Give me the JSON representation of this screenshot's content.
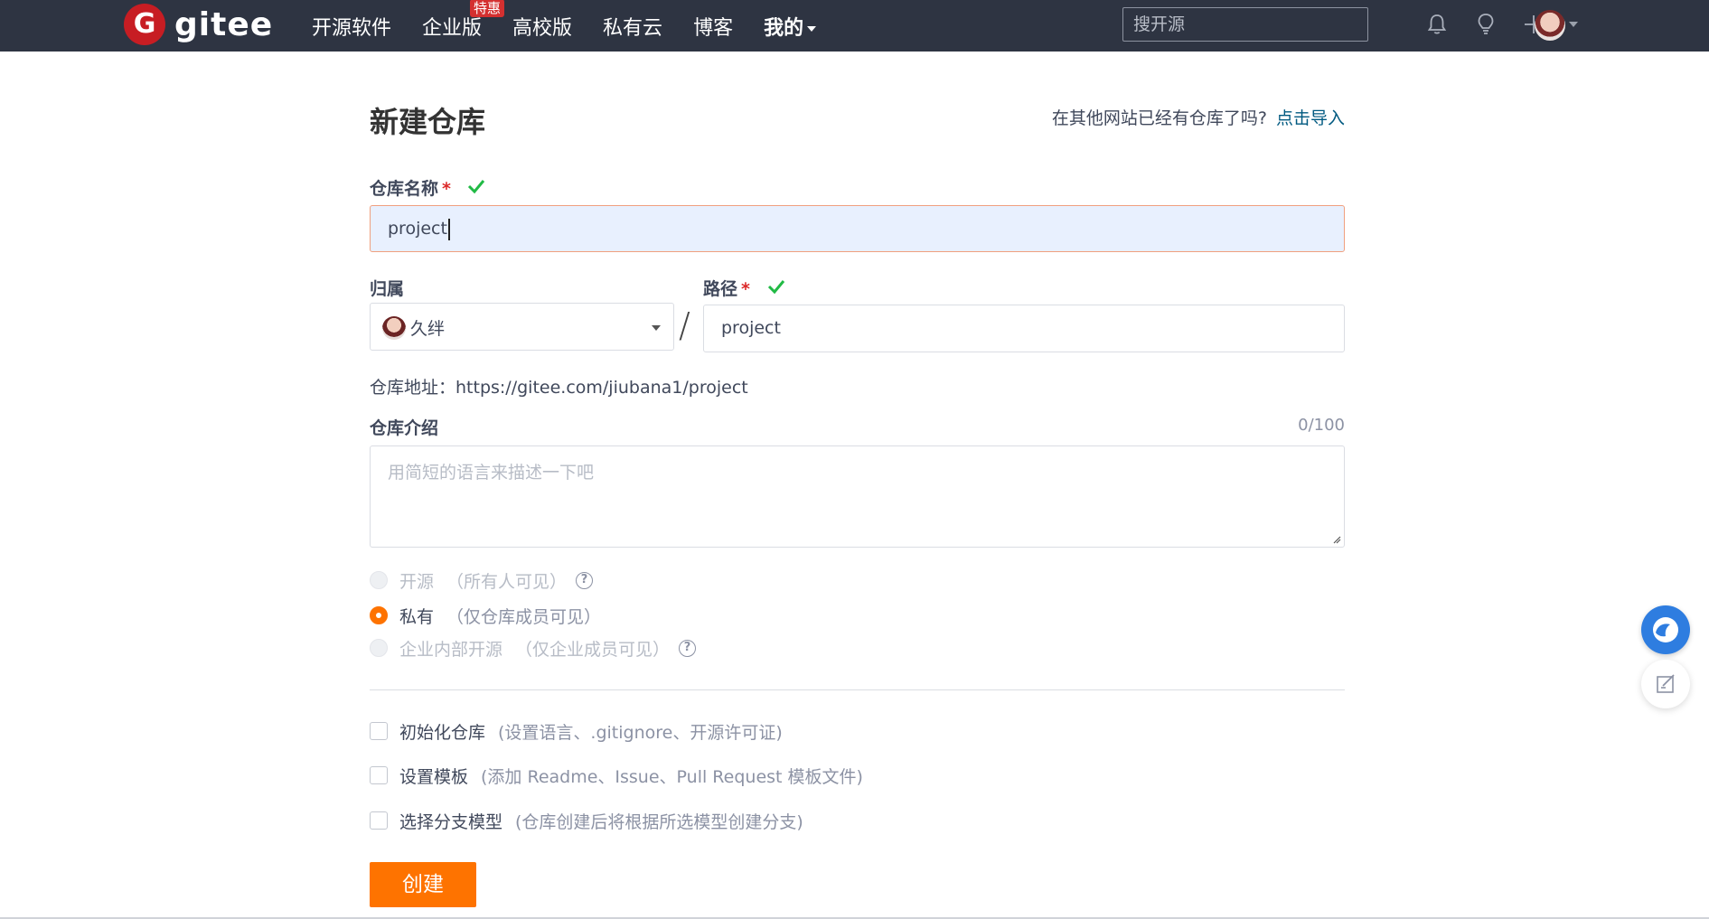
{
  "navbar": {
    "logo_letter": "G",
    "logo_text": "gitee",
    "items": [
      {
        "label": "开源软件"
      },
      {
        "label": "企业版",
        "badge": "特惠"
      },
      {
        "label": "高校版"
      },
      {
        "label": "私有云"
      },
      {
        "label": "博客"
      },
      {
        "label": "我的"
      }
    ],
    "search_placeholder": "搜开源",
    "icons": [
      "bell-icon",
      "lightbulb-icon",
      "plus-icon",
      "user-avatar"
    ]
  },
  "page": {
    "title": "新建仓库",
    "import_prompt": "在其他网站已经有仓库了吗?",
    "import_link": "点击导入"
  },
  "form": {
    "name_label": "仓库名称",
    "required_mark": "*",
    "name_value": "project",
    "owner_label": "归属",
    "owner_value": "久绊",
    "path_separator": "/",
    "path_label": "路径",
    "path_value": "project",
    "repo_url": "仓库地址：https://gitee.com/jiubana1/project",
    "intro_label": "仓库介绍",
    "intro_counter": "0/100",
    "intro_placeholder": "用简短的语言来描述一下吧",
    "visibility": [
      {
        "label": "开源",
        "hint": "（所有人可见）",
        "selected": false,
        "disabled": true,
        "has_help": true
      },
      {
        "label": "私有",
        "hint": "（仅仓库成员可见）",
        "selected": true,
        "disabled": false,
        "has_help": false
      },
      {
        "label": "企业内部开源",
        "hint": "（仅企业成员可见）",
        "selected": false,
        "disabled": true,
        "has_help": true
      }
    ],
    "options": [
      {
        "label": "初始化仓库",
        "hint": "(设置语言、.gitignore、开源许可证)",
        "checked": false
      },
      {
        "label": "设置模板",
        "hint": "(添加 Readme、Issue、Pull Request 模板文件)",
        "checked": false
      },
      {
        "label": "选择分支模型",
        "hint": "(仓库创建后将根据所选模型创建分支)",
        "checked": false
      }
    ],
    "submit_label": "创建"
  },
  "colors": {
    "navbar_bg": "#2e3442",
    "accent_orange": "#fe7300",
    "link_blue": "#005980",
    "valid_green": "#21ba45",
    "required_red": "#db2828"
  }
}
